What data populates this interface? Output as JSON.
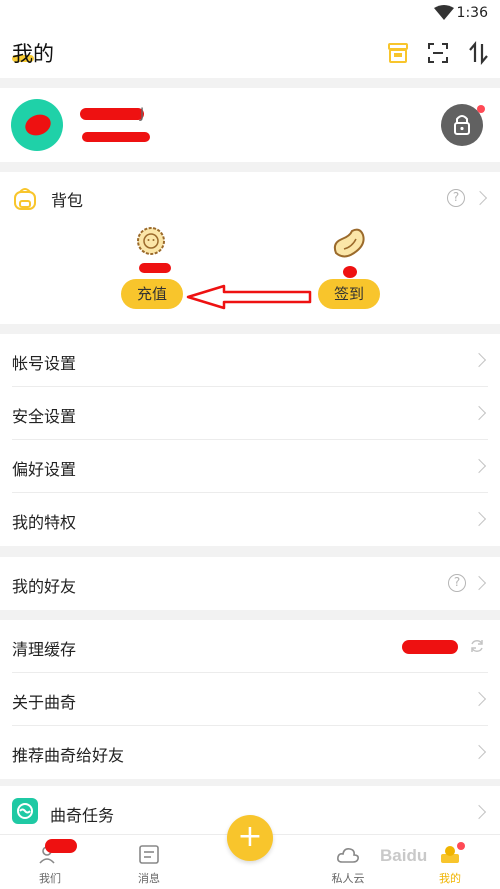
{
  "status_bar": {
    "time": "1:36"
  },
  "header": {
    "title": "我的"
  },
  "profile": {
    "name_suffix": "J"
  },
  "backpack": {
    "title": "背包",
    "help_glyph": "?",
    "recharge_label": "充值",
    "checkin_label": "签到"
  },
  "settings_group_1": [
    {
      "label": "帐号设置"
    },
    {
      "label": "安全设置"
    },
    {
      "label": "偏好设置"
    },
    {
      "label": "我的特权"
    }
  ],
  "friends": {
    "label": "我的好友",
    "help_glyph": "?"
  },
  "settings_group_2": [
    {
      "label": "清理缓存"
    },
    {
      "label": "关于曲奇"
    },
    {
      "label": "推荐曲奇给好友"
    }
  ],
  "tasks": {
    "label": "曲奇任务"
  },
  "bottom_nav": {
    "items": [
      {
        "label": "我们"
      },
      {
        "label": "消息"
      },
      {
        "label": "私人云"
      },
      {
        "label": "我的"
      }
    ],
    "fab_glyph": "+"
  },
  "watermark": "Baidu",
  "colors": {
    "accent": "#f8c52c",
    "teal": "#1fd1a8",
    "active_nav": "#f0b400",
    "notify_dot": "#ff4a55"
  }
}
